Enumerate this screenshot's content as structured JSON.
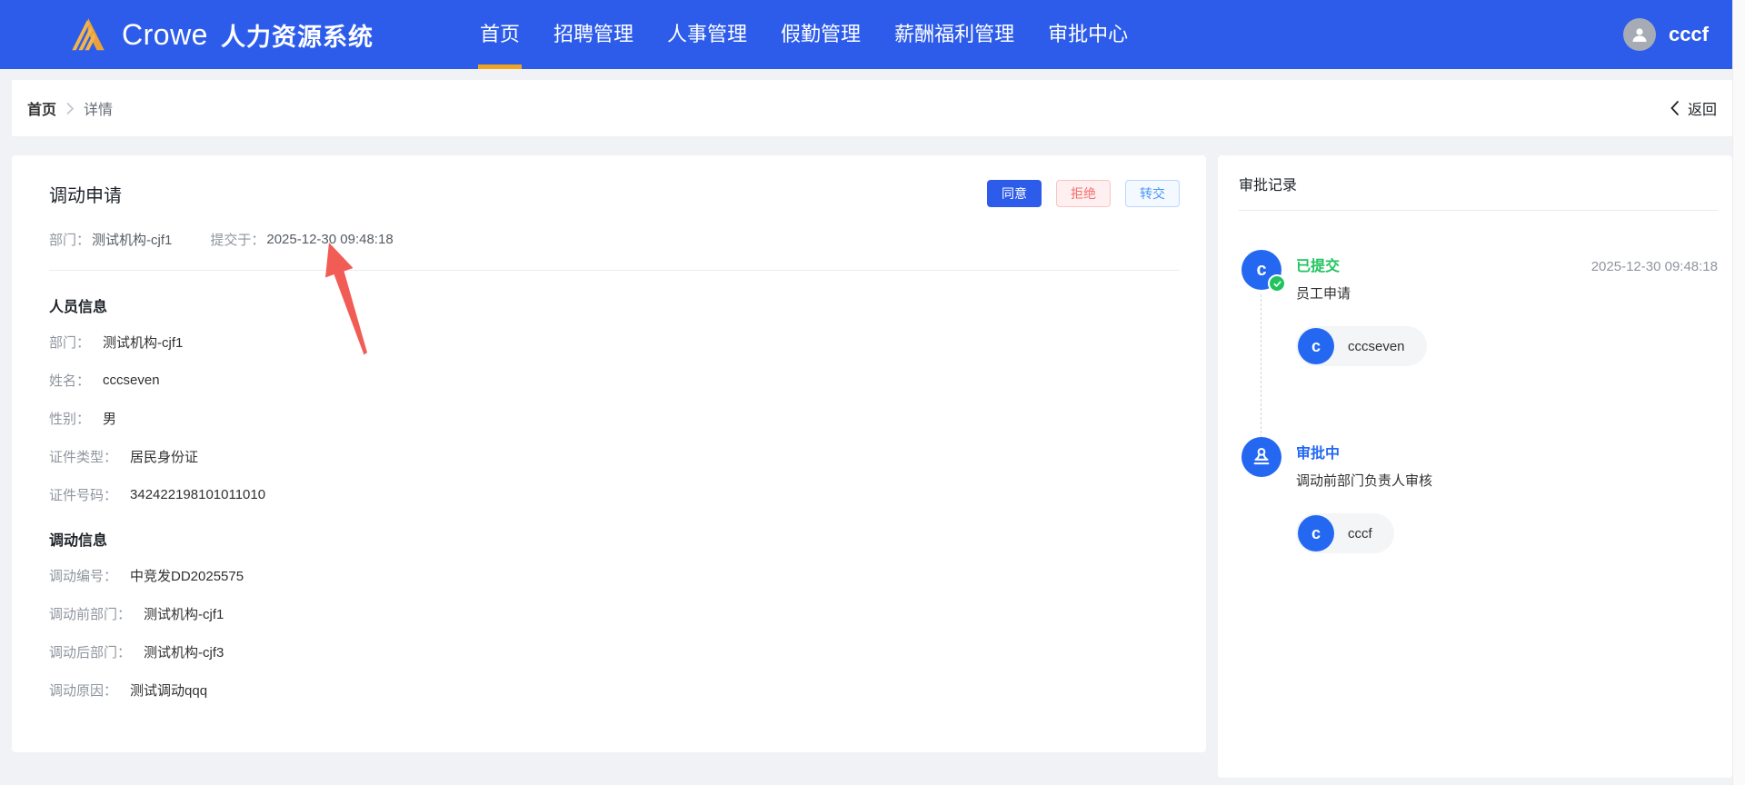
{
  "colors": {
    "primary_blue": "#2d5ceb",
    "nav_active_underline": "#f0a31d",
    "logo_gold": "#eda93f",
    "success_green": "#20c35e",
    "status_blue": "#2468f2",
    "reject_red": "#f56c6c",
    "arrow_red": "#f15c55",
    "page_bg": "#f1f2f6"
  },
  "nav": {
    "logo_text": "Crowe",
    "app_title": "人力资源系统",
    "items": [
      {
        "label": "首页",
        "active": true
      },
      {
        "label": "招聘管理",
        "active": false
      },
      {
        "label": "人事管理",
        "active": false
      },
      {
        "label": "假勤管理",
        "active": false
      },
      {
        "label": "薪酬福利管理",
        "active": false
      },
      {
        "label": "审批中心",
        "active": false
      }
    ],
    "user_name": "cccf"
  },
  "breadcrumb": {
    "home": "首页",
    "current": "详情",
    "back_label": "返回"
  },
  "detail": {
    "title": "调动申请",
    "actions": {
      "approve": "同意",
      "reject": "拒绝",
      "transfer": "转交"
    },
    "meta": {
      "dept_label": "部门：",
      "dept_value": "测试机构-cjf1",
      "submit_label": "提交于：",
      "submit_time": "2025-12-30 09:48:18"
    },
    "sections": [
      {
        "title": "人员信息",
        "fields": [
          {
            "label": "部门：",
            "value": "测试机构-cjf1"
          },
          {
            "label": "姓名：",
            "value": "cccseven"
          },
          {
            "label": "性别：",
            "value": "男"
          },
          {
            "label": "证件类型：",
            "value": "居民身份证"
          },
          {
            "label": "证件号码：",
            "value": "342422198101011010"
          }
        ]
      },
      {
        "title": "调动信息",
        "fields": [
          {
            "label": "调动编号：",
            "value": "中竞发DD2025575"
          },
          {
            "label": "调动前部门：",
            "value": "测试机构-cjf1"
          },
          {
            "label": "调动后部门：",
            "value": "测试机构-cjf3"
          },
          {
            "label": "调动原因：",
            "value": "测试调动qqq"
          }
        ]
      }
    ]
  },
  "approval": {
    "title": "审批记录",
    "steps": [
      {
        "status": "已提交",
        "desc": "员工申请",
        "time": "2025-12-30 09:48:18",
        "avatar_letter": "c",
        "badge": "check",
        "people": [
          {
            "letter": "c",
            "name": "cccseven"
          }
        ]
      },
      {
        "status": "审批中",
        "desc": "调动前部门负责人审核",
        "icon": "stamp",
        "people": [
          {
            "letter": "c",
            "name": "cccf"
          }
        ]
      }
    ]
  }
}
